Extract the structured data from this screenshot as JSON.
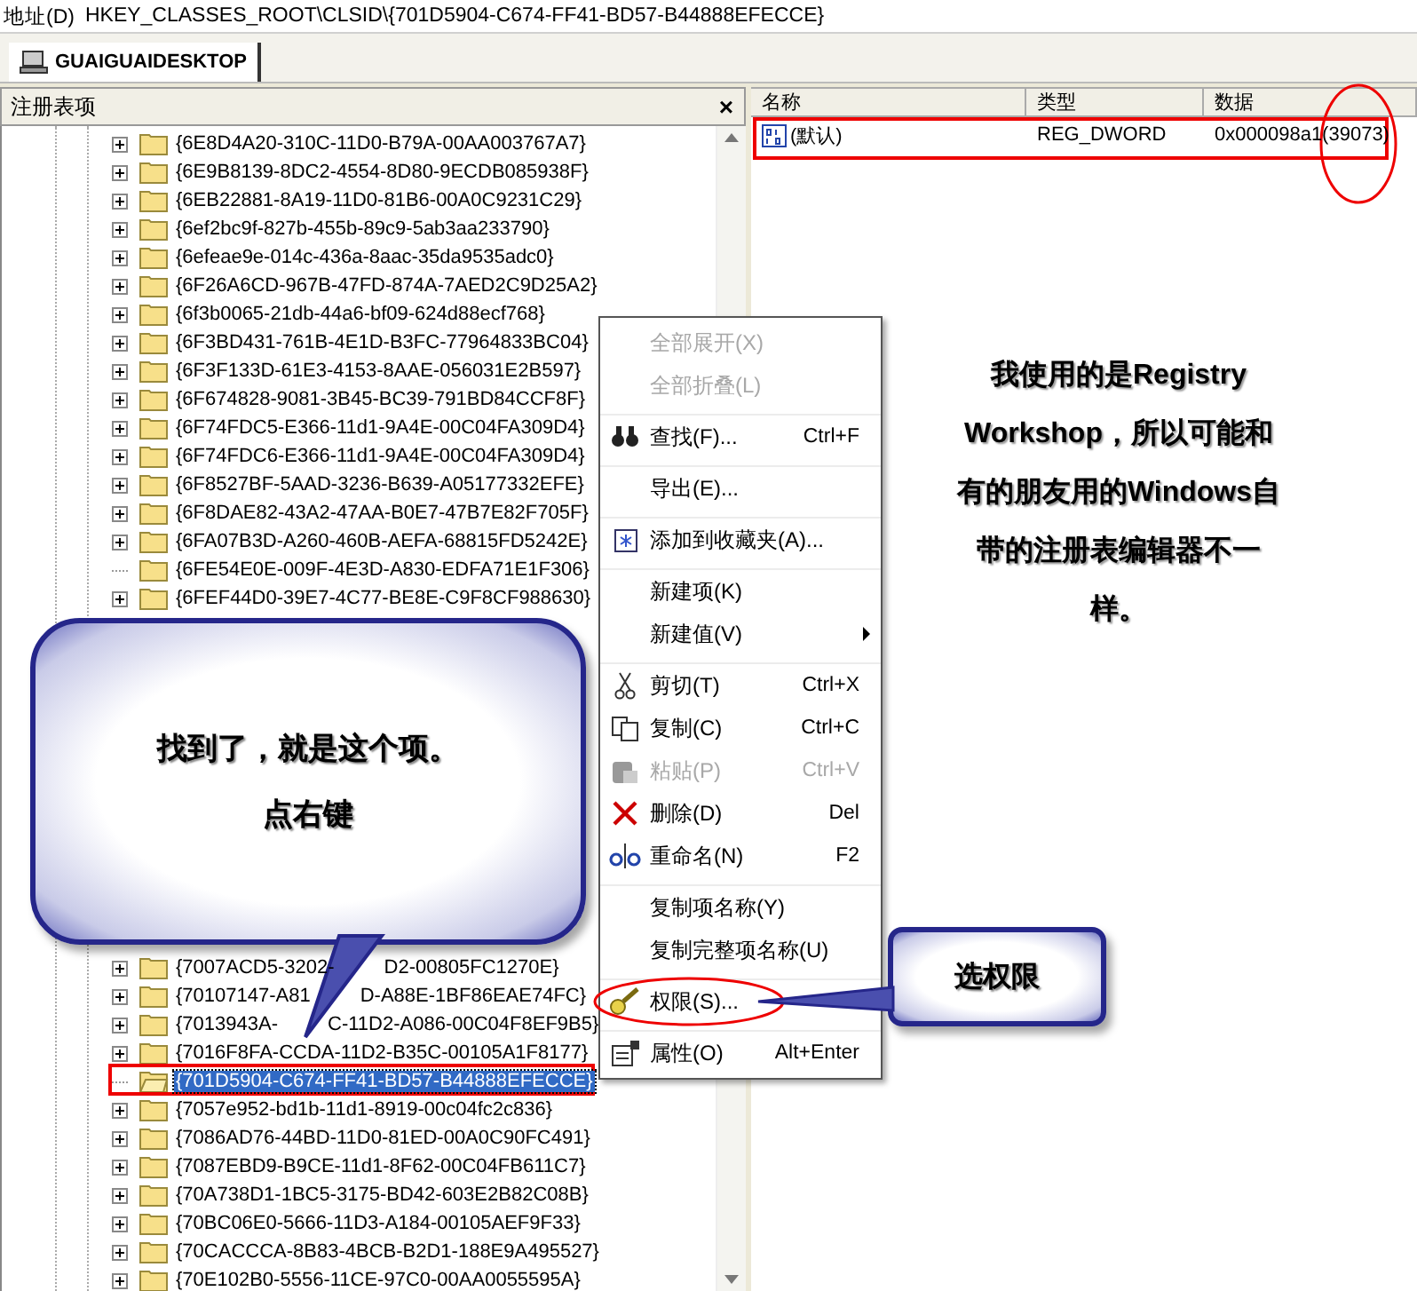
{
  "address_bar": {
    "label": "地址(D)",
    "value": "HKEY_CLASSES_ROOT\\CLSID\\{701D5904-C674-FF41-BD57-B44888EFECCE}"
  },
  "tabs": [
    {
      "label": "GUAIGUAIDESKTOP",
      "selected": true
    }
  ],
  "tree_panel": {
    "title": "注册表项",
    "close": "×",
    "rows_above": [
      {
        "segments": [
          "{6E8D4A20-310C-11D0-B79A-00AA003767A7}"
        ],
        "expandable": true,
        "selected": false
      },
      {
        "segments": [
          "{6E9B8139-8DC2-4554-8D80-9ECDB085938F}"
        ],
        "expandable": true,
        "selected": false
      },
      {
        "segments": [
          "{6EB22881-8A19-11D0-81B6-00A0C9231C29}"
        ],
        "expandable": true,
        "selected": false
      },
      {
        "segments": [
          "{6ef2bc9f-827b-455b-89c9-5ab3aa233790}"
        ],
        "expandable": true,
        "selected": false
      },
      {
        "segments": [
          "{6efeae9e-014c-436a-8aac-35da9535adc0}"
        ],
        "expandable": true,
        "selected": false
      },
      {
        "segments": [
          "{6F26A6CD-967B-47FD-874A-7AED2C9D25A2}"
        ],
        "expandable": true,
        "selected": false
      },
      {
        "segments": [
          "{6f3b0065-21db-44a6-bf09-624d88ecf768}"
        ],
        "expandable": true,
        "selected": false
      },
      {
        "segments": [
          "{6F3BD431-761B-4E1D-B3FC-77964833BC04}"
        ],
        "expandable": true,
        "selected": false
      },
      {
        "segments": [
          "{6F3F133D-61E3-4153-8AAE-056031E2B597}"
        ],
        "expandable": true,
        "selected": false
      },
      {
        "segments": [
          "{6F674828-9081-3B45-BC39-791BD84CCF8F}"
        ],
        "expandable": true,
        "selected": false
      },
      {
        "segments": [
          "{6F74FDC5-E366-11d1-9A4E-00C04FA309D4}"
        ],
        "expandable": true,
        "selected": false
      },
      {
        "segments": [
          "{6F74FDC6-E366-11d1-9A4E-00C04FA309D4}"
        ],
        "expandable": true,
        "selected": false
      },
      {
        "segments": [
          "{6F8527BF-5AAD-3236-B639-A05177332EFE}"
        ],
        "expandable": true,
        "selected": false
      },
      {
        "segments": [
          "{6F8DAE82-43A2-47AA-B0E7-47B7E82F705F}"
        ],
        "expandable": true,
        "selected": false
      },
      {
        "segments": [
          "{6FA07B3D-A260-460B-AEFA-68815FD5242E}"
        ],
        "expandable": true,
        "selected": false
      },
      {
        "segments": [
          "{6FE54E0E-009F-4E3D-A830-EDFA71E1F306}"
        ],
        "expandable": false,
        "selected": false
      },
      {
        "segments": [
          "{6FEF44D0-39E7-4C77-BE8E-C9F8CF988630}"
        ],
        "expandable": true,
        "selected": false
      }
    ],
    "rows_below": [
      {
        "segments": [
          "{7007ACD5-3202-",
          "D2-00805FC1270E}"
        ],
        "expandable": true,
        "selected": false
      },
      {
        "segments": [
          "{70107147-A81",
          "D-A88E-1BF86EAE74FC}"
        ],
        "expandable": true,
        "selected": false
      },
      {
        "segments": [
          "{7013943A-",
          "C-11D2-A086-00C04F8EF9B5}"
        ],
        "expandable": true,
        "selected": false
      },
      {
        "segments": [
          "{7016F8FA-CCDA-11D2-B35C-00105A1F8177}"
        ],
        "expandable": true,
        "selected": false
      },
      {
        "segments": [
          "{701D5904-C674-FF41-BD57-B44888EFECCE}"
        ],
        "expandable": false,
        "selected": true
      },
      {
        "segments": [
          "{7057e952-bd1b-11d1-8919-00c04fc2c836}"
        ],
        "expandable": true,
        "selected": false
      },
      {
        "segments": [
          "{7086AD76-44BD-11D0-81ED-00A0C90FC491}"
        ],
        "expandable": true,
        "selected": false
      },
      {
        "segments": [
          "{7087EBD9-B9CE-11d1-8F62-00C04FB611C7}"
        ],
        "expandable": true,
        "selected": false
      },
      {
        "segments": [
          "{70A738D1-1BC5-3175-BD42-603E2B82C08B}"
        ],
        "expandable": true,
        "selected": false
      },
      {
        "segments": [
          "{70BC06E0-5666-11D3-A184-00105AEF9F33}"
        ],
        "expandable": true,
        "selected": false
      },
      {
        "segments": [
          "{70CACCCA-8B83-4BCB-B2D1-188E9A495527}"
        ],
        "expandable": true,
        "selected": false
      },
      {
        "segments": [
          "{70E102B0-5556-11CE-97C0-00AA0055595A}"
        ],
        "expandable": true,
        "selected": false
      }
    ]
  },
  "values_panel": {
    "columns": [
      "名称",
      "类型",
      "数据"
    ],
    "rows": [
      {
        "name": "(默认)",
        "type": "REG_DWORD",
        "data": "0x000098a1(39073)"
      }
    ]
  },
  "context_menu": [
    {
      "label": "全部展开(X)",
      "disabled": true,
      "separator": false
    },
    {
      "label": "全部折叠(L)",
      "disabled": true,
      "separator": false
    },
    {
      "label": "查找(F)...",
      "shortcut": "Ctrl+F",
      "kind": "binoculars",
      "disabled": false,
      "separator": true
    },
    {
      "label": "导出(E)...",
      "disabled": false,
      "separator": true
    },
    {
      "label": "添加到收藏夹(A)...",
      "kind": "favorite",
      "disabled": false,
      "separator": true
    },
    {
      "label": "新建项(K)",
      "disabled": false,
      "separator": true
    },
    {
      "label": "新建值(V)",
      "submenu": true,
      "disabled": false,
      "separator": false
    },
    {
      "label": "剪切(T)",
      "shortcut": "Ctrl+X",
      "kind": "cut",
      "disabled": false,
      "separator": true
    },
    {
      "label": "复制(C)",
      "shortcut": "Ctrl+C",
      "kind": "copy",
      "disabled": false,
      "separator": false
    },
    {
      "label": "粘贴(P)",
      "shortcut": "Ctrl+V",
      "kind": "paste",
      "disabled": true,
      "separator": false
    },
    {
      "label": "删除(D)",
      "shortcut": "Del",
      "kind": "delete",
      "disabled": false,
      "separator": false
    },
    {
      "label": "重命名(N)",
      "shortcut": "F2",
      "kind": "rename",
      "disabled": false,
      "separator": false
    },
    {
      "label": "复制项名称(Y)",
      "disabled": false,
      "separator": true
    },
    {
      "label": "复制完整项名称(U)",
      "disabled": false,
      "separator": false
    },
    {
      "label": "权限(S)...",
      "kind": "key",
      "disabled": false,
      "separator": true
    },
    {
      "label": "属性(O)",
      "shortcut": "Alt+Enter",
      "kind": "properties",
      "disabled": false,
      "separator": true
    }
  ],
  "callouts": [
    {
      "lines": [
        "找到了，就是这个项。",
        "点右键"
      ]
    },
    {
      "lines": [
        "选权限"
      ]
    }
  ],
  "note": "我使用的是Registry Workshop，所以可能和有的朋友用的Windows自带的注册表编辑器不一样。"
}
